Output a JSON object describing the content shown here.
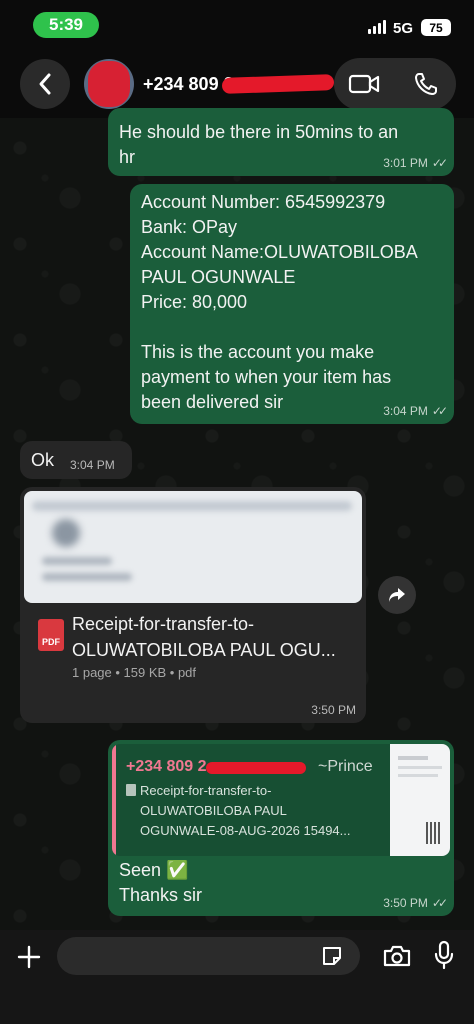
{
  "status_bar": {
    "time": "5:39",
    "network": "5G",
    "battery": "75"
  },
  "header": {
    "contact_name": "+234 809 2",
    "icons": [
      "back-icon",
      "video-call-icon",
      "phone-icon"
    ]
  },
  "messages": [
    {
      "direction": "out",
      "text": "He should be there in 50mins to an\nhr",
      "time": "3:01 PM"
    },
    {
      "direction": "out",
      "text": "Account Number: 6545992379\nBank: OPay\nAccount Name:OLUWATOBILOBA\nPAUL OGUNWALE\nPrice: 80,000\n\nThis is the account you make\npayment to when your item has\nbeen delivered sir",
      "time": "3:04 PM"
    },
    {
      "direction": "in",
      "text": "Ok",
      "time": "3:04 PM"
    },
    {
      "direction": "in",
      "type": "document",
      "doc_badge": "PDF",
      "doc_title": "Receipt-for-transfer-to-\nOLUWATOBILOBA PAUL OGU...",
      "doc_meta": "1 page • 159 KB • pdf",
      "time": "3:50 PM"
    },
    {
      "direction": "out",
      "type": "reply",
      "quote_sender": "+234 809 2",
      "quote_alias": "~Prince",
      "quote_text": "Receipt-for-transfer-to-\nOLUWATOBILOBA PAUL\nOGUNWALE-08-AUG-2026 15494...",
      "text": "Seen ✅\nThanks sir",
      "time": "3:50 PM"
    }
  ],
  "colors": {
    "outgoing_bubble": "#1b5e3b",
    "incoming_bubble": "#262626",
    "status_pill": "#2fc24c",
    "quote_accent": "#f07891"
  }
}
